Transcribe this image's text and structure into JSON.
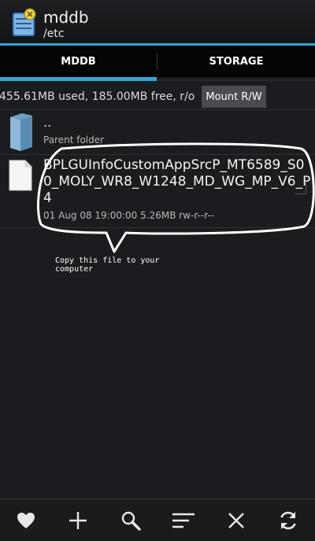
{
  "app": {
    "title": "mddb",
    "subtitle": "/etc"
  },
  "tabs": [
    {
      "label": "MDDB",
      "selected": true
    },
    {
      "label": "STORAGE",
      "selected": false
    }
  ],
  "info": {
    "text": "455.61MB used, 185.00MB free, r/o",
    "mount_label": "Mount R/W"
  },
  "files": {
    "parent": {
      "name": "..",
      "label": "Parent folder"
    },
    "file": {
      "name": "BPLGUInfoCustomAppSrcP_MT6589_S00_MOLY_WR8_W1248_MD_WG_MP_V6_P4",
      "meta": "01 Aug 08 19:00:00  5.26MB  rw-r--r--"
    }
  },
  "annotation": {
    "text": "Copy this file to your computer"
  },
  "toolbar": {
    "icons": [
      "heart-icon",
      "plus-icon",
      "search-icon",
      "sort-icon",
      "close-icon",
      "refresh-icon"
    ]
  },
  "colors": {
    "accent": "#2fa7d8",
    "background": "#1b1c1f"
  }
}
